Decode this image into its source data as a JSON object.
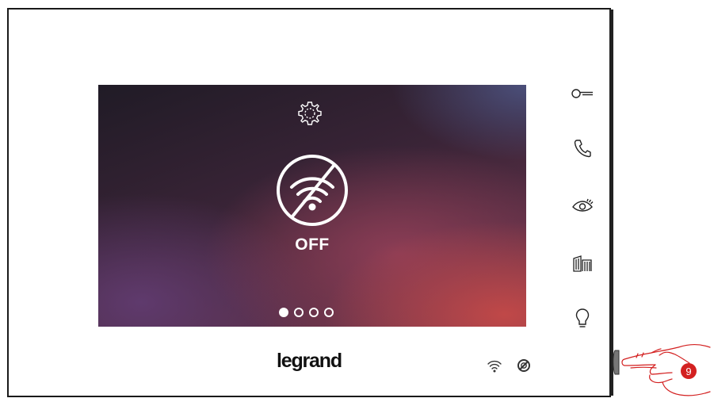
{
  "screen": {
    "settings_icon": "gear-icon",
    "status_icon": "wifi-off-icon",
    "status_label": "OFF",
    "pager": {
      "total": 4,
      "active": 1
    }
  },
  "side_buttons": [
    {
      "icon": "key-icon"
    },
    {
      "icon": "phone-handset-icon"
    },
    {
      "icon": "eye-icon"
    },
    {
      "icon": "gate-icon"
    },
    {
      "icon": "light-bulb-icon"
    }
  ],
  "brand": {
    "logo": "legrand"
  },
  "status_bar": [
    {
      "icon": "wifi-signal-icon"
    },
    {
      "icon": "do-not-disturb-icon"
    }
  ],
  "annotation": {
    "step_number": "9",
    "color": "#d32020"
  }
}
